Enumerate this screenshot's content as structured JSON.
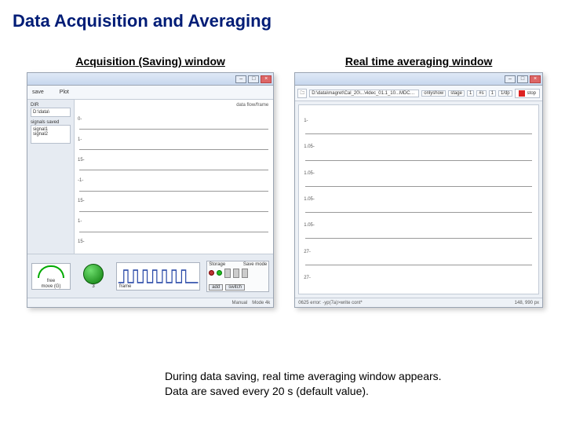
{
  "title": "Data Acquisition and Averaging",
  "left": {
    "caption": "Acquisition (Saving) window",
    "toolbar": {
      "saveTab": "save",
      "plotTab": "Plot"
    },
    "sidebar": {
      "dirLabel": "DIR",
      "dirValue": "D:\\data\\",
      "signalsLabel": "signals saved",
      "signalsValue": "signal1\nsignal2"
    },
    "plotArea": {
      "header": "data flow/frame",
      "rows": [
        "0-",
        "1-",
        "15-",
        "-1-",
        "15-",
        "1-",
        "15-"
      ]
    },
    "bottom": {
      "gauge": {
        "label": "free",
        "unit": "move (G)"
      },
      "knob": {
        "value": "3"
      },
      "pulses": {
        "label": "frame"
      },
      "endPanel": {
        "topLabel": "Storage",
        "rightLabel": "Save mode",
        "buttons": [
          "add",
          "switch"
        ]
      }
    },
    "status": {
      "a": "Manual",
      "b": "Mode 4k"
    }
  },
  "right": {
    "caption": "Real time averaging window",
    "toolbar": {
      "path": "D:\\data\\magret\\Cal_20\\...\\4dec_01.1_10...MDC_01.1.csv",
      "fields": [
        {
          "label": "onlyshow",
          "value": ""
        },
        {
          "label": "stage",
          "value": "1"
        },
        {
          "label": "#s",
          "value": "1"
        },
        {
          "label": "1/dp",
          "value": ""
        }
      ],
      "stop": "stop"
    },
    "plotArea": {
      "rows": [
        "1-",
        "1.05-",
        "1.05-",
        "1.05-",
        "1.05-",
        "27-",
        "27-"
      ]
    },
    "status": {
      "left": "0625 error: -yp(7a)>write cont*",
      "right": "148, 990 px"
    }
  },
  "body": {
    "line1": "During data saving, real time averaging window appears.",
    "line2": "Data are saved every 20 s (default value)."
  }
}
